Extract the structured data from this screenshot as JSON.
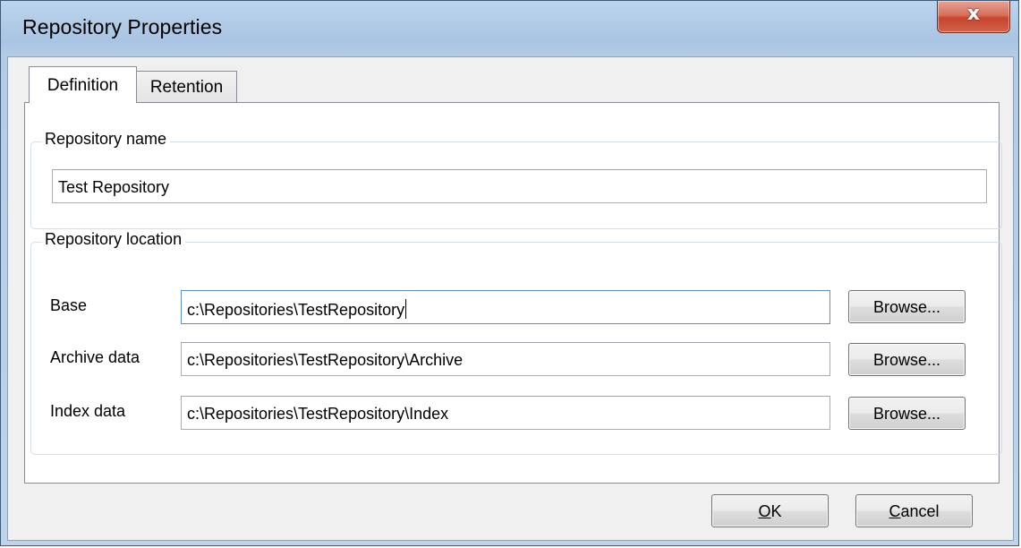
{
  "window": {
    "title": "Repository Properties",
    "close_glyph": "x"
  },
  "tabs": [
    {
      "label": "Definition",
      "active": true
    },
    {
      "label": "Retention",
      "active": false
    }
  ],
  "name_group": {
    "legend": "Repository name",
    "value": "Test Repository"
  },
  "location_group": {
    "legend": "Repository location",
    "rows": [
      {
        "label": "Base",
        "value": "c:\\Repositories\\TestRepository",
        "button": "Browse...",
        "focused": true
      },
      {
        "label": "Archive data",
        "value": "c:\\Repositories\\TestRepository\\Archive",
        "button": "Browse..."
      },
      {
        "label": "Index data",
        "value": "c:\\Repositories\\TestRepository\\Index",
        "button": "Browse..."
      }
    ]
  },
  "buttons": {
    "ok": "OK",
    "cancel": "Cancel"
  },
  "colors": {
    "title_bar": "#a9c4e3",
    "close_button": "#c7452d",
    "dialog_background": "#f0f0f0",
    "focus_border": "#5c93bc"
  },
  "icons": {
    "close": "close-icon"
  }
}
